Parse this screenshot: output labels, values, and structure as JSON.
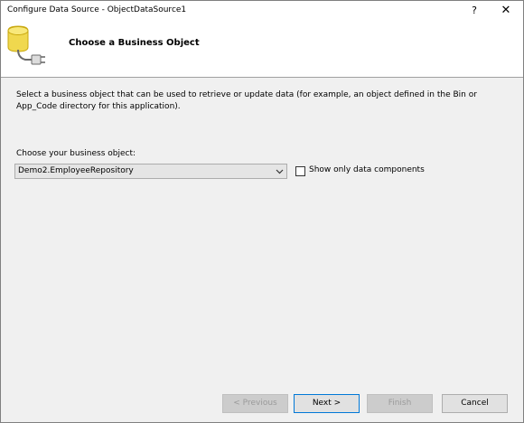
{
  "window": {
    "title": "Configure Data Source - ObjectDataSource1"
  },
  "titlebar": {
    "help": "?",
    "close": "✕"
  },
  "header": {
    "title": "Choose a Business Object"
  },
  "body": {
    "description": "Select a business object that can be used to retrieve or update data (for example, an object defined in the Bin or App_Code directory for this application).",
    "choose_label": "Choose your business object:",
    "selected_object": "Demo2.EmployeeRepository",
    "show_only_label": "Show only data components",
    "show_only_checked": false
  },
  "footer": {
    "previous": "< Previous",
    "next": "Next >",
    "finish": "Finish",
    "cancel": "Cancel"
  },
  "icons": {
    "header": "database-plug-icon",
    "dropdown": "chevron-down-icon"
  },
  "colors": {
    "accent": "#0078d7",
    "header_bg": "#ffffff",
    "dialog_bg": "#f0f0f0"
  }
}
